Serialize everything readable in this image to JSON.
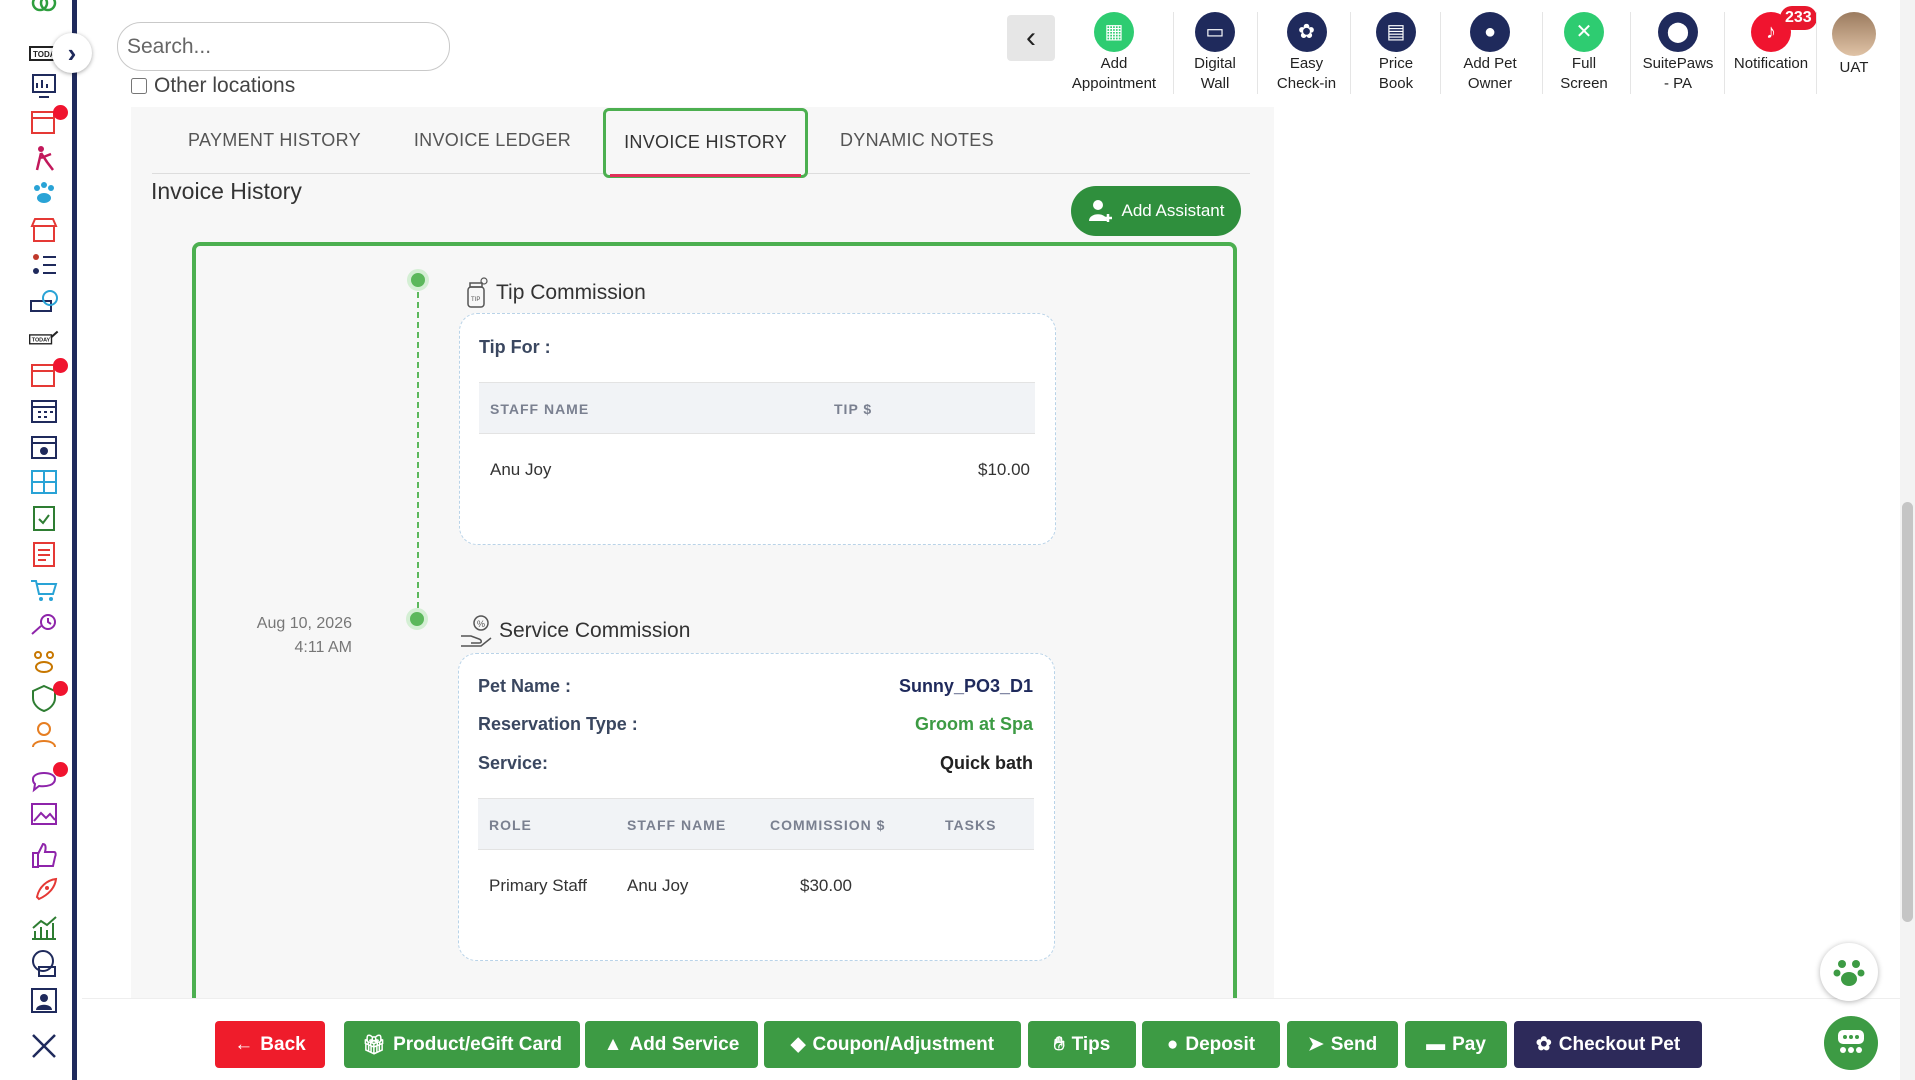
{
  "search": {
    "placeholder": "Search..."
  },
  "other_locations": "Other locations",
  "toolbar": {
    "items": [
      {
        "label1": "Add",
        "label2": "Appointment",
        "icon": "calendar-add-icon",
        "color": "#2ecc71"
      },
      {
        "label1": "Digital",
        "label2": "Wall",
        "icon": "monitor-icon",
        "color": "#1f2a5c"
      },
      {
        "label1": "Easy",
        "label2": "Check-in",
        "icon": "paw-icon",
        "color": "#1f2a5c"
      },
      {
        "label1": "Price",
        "label2": "Book",
        "icon": "book-icon",
        "color": "#1f2a5c"
      },
      {
        "label1": "Add Pet",
        "label2": "Owner",
        "icon": "add-user-icon",
        "color": "#1f2a5c"
      },
      {
        "label1": "Full",
        "label2": "Screen",
        "icon": "fullscreen-icon",
        "color": "#2ecc71"
      },
      {
        "label1": "SuitePaws",
        "label2": "- PA",
        "icon": "location-icon",
        "color": "#1f2a5c"
      },
      {
        "label1": "Notification",
        "label2": "",
        "icon": "bell-icon",
        "color": "#f0142f"
      }
    ],
    "notification_count": "233",
    "user_label": "UAT"
  },
  "tabs": [
    {
      "label": "PAYMENT HISTORY"
    },
    {
      "label": "INVOICE LEDGER"
    },
    {
      "label": "INVOICE HISTORY"
    },
    {
      "label": "DYNAMIC NOTES"
    }
  ],
  "page_title": "Invoice History",
  "add_assistant_label": "Add Assistant",
  "timeline": {
    "date": "Aug 10, 2026",
    "time": "4:11 AM",
    "tip": {
      "title": "Tip Commission",
      "tip_for_label": "Tip For :",
      "columns": [
        "STAFF NAME",
        "TIP $"
      ],
      "rows": [
        {
          "staff": "Anu Joy",
          "tip": "$10.00"
        }
      ]
    },
    "service": {
      "title": "Service Commission",
      "pet_label": "Pet Name :",
      "pet_value": "Sunny_PO3_D1",
      "reservation_label": "Reservation Type :",
      "reservation_value": "Groom at Spa",
      "service_label": "Service:",
      "service_value": "Quick bath",
      "columns": [
        "ROLE",
        "STAFF NAME",
        "COMMISSION $",
        "TASKS"
      ],
      "rows": [
        {
          "role": "Primary Staff",
          "staff": "Anu Joy",
          "commission": "$30.00",
          "tasks": ""
        }
      ]
    }
  },
  "buttons": {
    "back": "Back",
    "product": "Product/eGift Card",
    "add_service": "Add Service",
    "coupon": "Coupon/Adjustment",
    "tips": "Tips",
    "deposit": "Deposit",
    "send": "Send",
    "pay": "Pay",
    "checkout": "Checkout Pet"
  },
  "colors": {
    "accent_green": "#3d9b44",
    "danger": "#f0142f",
    "navy": "#2d2a5a"
  }
}
